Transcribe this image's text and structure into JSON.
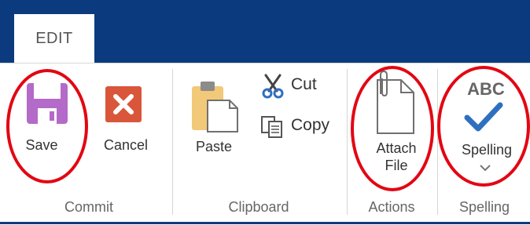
{
  "tabs": [
    {
      "label": "EDIT"
    }
  ],
  "groups": {
    "commit": {
      "label": "Commit",
      "save_label": "Save",
      "cancel_label": "Cancel"
    },
    "clipboard": {
      "label": "Clipboard",
      "paste_label": "Paste",
      "cut_label": "Cut",
      "copy_label": "Copy"
    },
    "actions": {
      "label": "Actions",
      "attach_line1": "Attach",
      "attach_line2": "File"
    },
    "spelling": {
      "label": "Spelling",
      "spelling_label": "Spelling",
      "abc_text": "ABC"
    }
  },
  "colors": {
    "header": "#0b3b7e",
    "save_icon": "#b46ac8",
    "cancel_icon": "#d9563a",
    "highlight_circle": "#e30613",
    "check": "#2e6fc0"
  },
  "icons": [
    "save-icon",
    "cancel-icon",
    "paste-icon",
    "cut-icon",
    "copy-icon",
    "attach-file-icon",
    "spelling-icon"
  ]
}
